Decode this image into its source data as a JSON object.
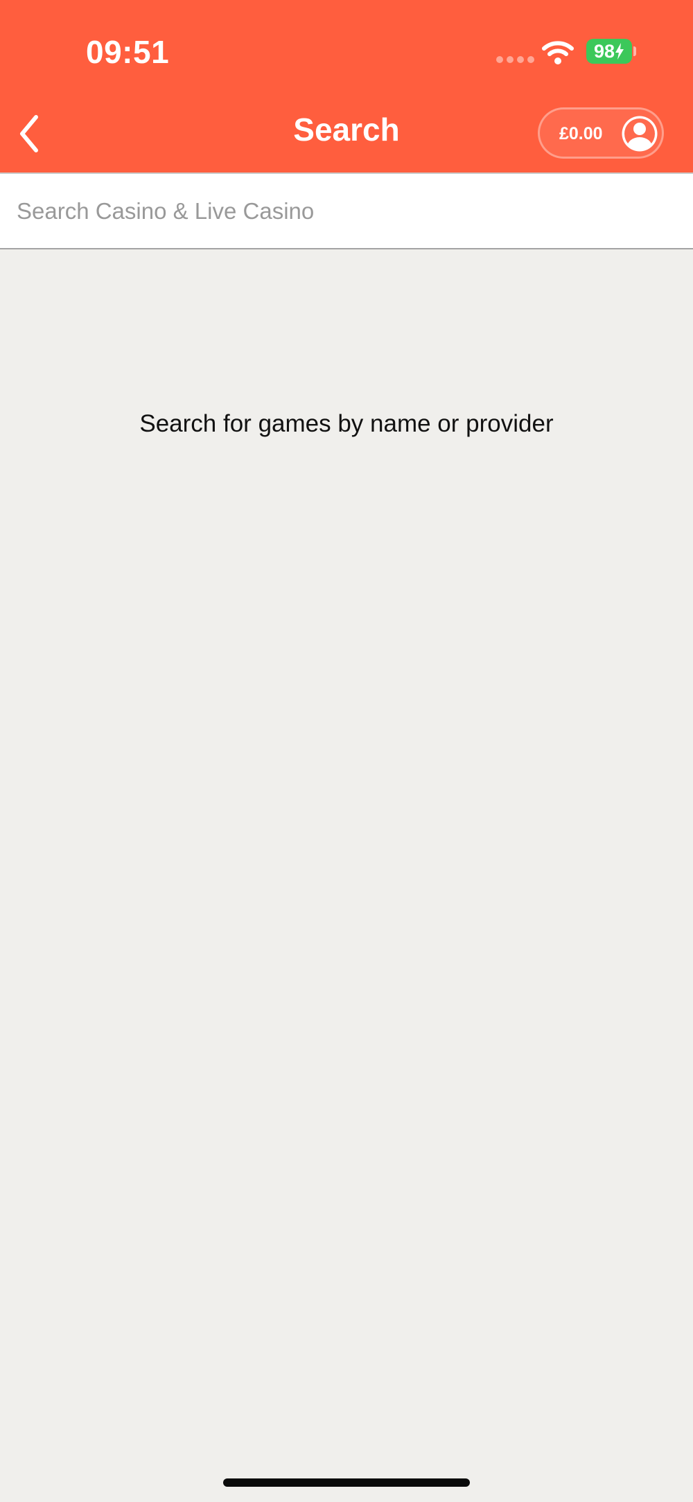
{
  "status_bar": {
    "time": "09:51",
    "battery_level": "98",
    "signal_icon": "cellular-signal-dots",
    "wifi_icon": "wifi-icon",
    "battery_icon": "battery-charging-icon"
  },
  "header": {
    "title": "Search",
    "back_icon": "chevron-left-icon",
    "balance": "£0.00",
    "account_icon": "user-avatar-icon"
  },
  "search": {
    "value": "",
    "placeholder": "Search Casino & Live Casino"
  },
  "main": {
    "empty_message": "Search for games by name or provider"
  },
  "colors": {
    "brand": "#ff5e3e",
    "background": "#f0efec",
    "battery": "#3cc85a",
    "text": "#111111",
    "placeholder": "#999999"
  }
}
